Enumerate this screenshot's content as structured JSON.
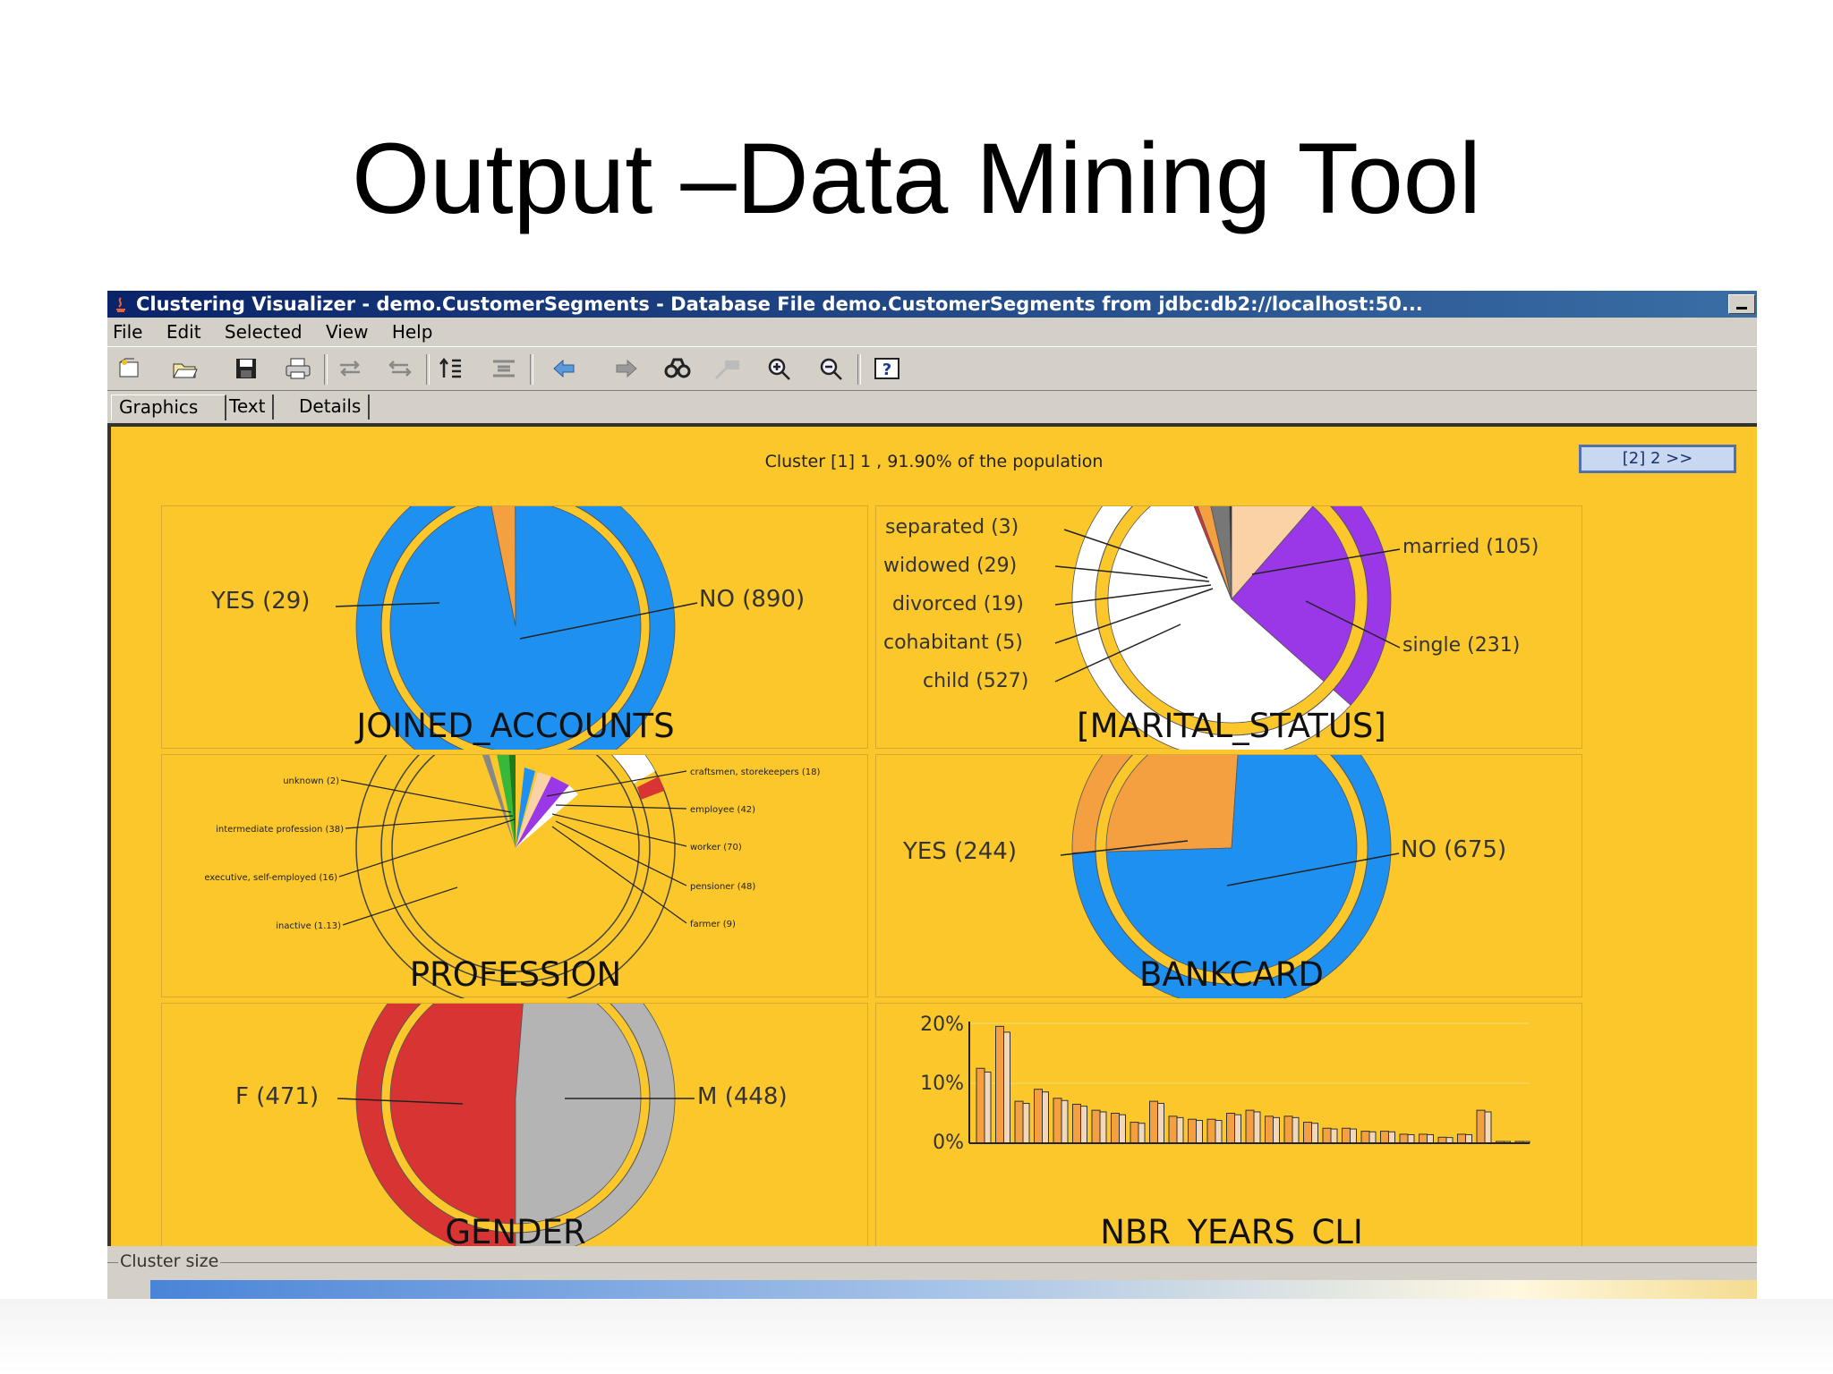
{
  "slide": {
    "title": "Output –Data Mining Tool"
  },
  "window": {
    "title": "Clustering Visualizer - demo.CustomerSegments - Database File demo.CustomerSegments from jdbc:db2://localhost:50...",
    "menu": [
      "File",
      "Edit",
      "Selected",
      "View",
      "Help"
    ],
    "tabs": [
      "Graphics",
      "Text",
      "Details"
    ],
    "toolbar_icons": [
      "new-icon",
      "open-icon",
      "save-icon",
      "print-icon",
      "undo-icon",
      "redo-icon",
      "sort-icon",
      "collapse-icon",
      "back-icon",
      "forward-icon",
      "find-icon",
      "highlight-icon",
      "zoom-in-icon",
      "zoom-out-icon",
      "help-icon"
    ],
    "cluster_header": "Cluster [1] 1 , 91.90% of the population",
    "next_button": "[2] 2 >>",
    "status_label": "Cluster size"
  },
  "colors": {
    "panel": "#fbc72b",
    "blue": "#1e90f0",
    "orange": "#f4a040",
    "purple": "#9a38e8",
    "red": "#d83434",
    "gray": "#b4b4b4",
    "peach": "#fad2a6"
  },
  "charts": {
    "joined_accounts": {
      "title": "JOINED_ACCOUNTS",
      "labels": {
        "yes": "YES (29)",
        "no": "NO (890)"
      },
      "chart_data": {
        "type": "pie",
        "slices": [
          {
            "label": "YES",
            "value": 29,
            "color": "#f4a040"
          },
          {
            "label": "NO",
            "value": 890,
            "color": "#1e90f0"
          }
        ]
      }
    },
    "marital_status": {
      "title": "[MARITAL_STATUS]",
      "labels": {
        "separated": "separated (3)",
        "widowed": "widowed (29)",
        "divorced": "divorced (19)",
        "cohabitant": "cohabitant (5)",
        "child": "child (527)",
        "married": "married (105)",
        "single": "single (231)"
      },
      "chart_data": {
        "type": "pie",
        "slices": [
          {
            "label": "married",
            "value": 105,
            "color": "#fad2a6"
          },
          {
            "label": "single",
            "value": 231,
            "color": "#9a38e8"
          },
          {
            "label": "child",
            "value": 527,
            "color": "#ffffff"
          },
          {
            "label": "cohabitant",
            "value": 5,
            "color": "#d83434"
          },
          {
            "label": "divorced",
            "value": 19,
            "color": "#f4a040"
          },
          {
            "label": "widowed",
            "value": 29,
            "color": "#777777"
          },
          {
            "label": "separated",
            "value": 3,
            "color": "#222222"
          }
        ]
      }
    },
    "profession": {
      "title": "PROFESSION",
      "labels": {
        "unknown": "unknown (2)",
        "intermediate": "intermediate profession (38)",
        "executive": "executive, self-employed (16)",
        "inactive": "inactive (1.13)",
        "craftsmen": "craftsmen, storekeepers (18)",
        "employee": "employee (42)",
        "worker": "worker (70)",
        "pensioner": "pensioner (48)",
        "farmer": "farmer (9)"
      }
    },
    "bankcard": {
      "title": "BANKCARD",
      "labels": {
        "yes": "YES (244)",
        "no": "NO (675)"
      },
      "chart_data": {
        "type": "pie",
        "slices": [
          {
            "label": "YES",
            "value": 244,
            "color": "#f4a040"
          },
          {
            "label": "NO",
            "value": 675,
            "color": "#1e90f0"
          }
        ]
      }
    },
    "gender": {
      "title": "GENDER",
      "labels": {
        "f": "F (471)",
        "m": "M (448)"
      },
      "chart_data": {
        "type": "pie",
        "slices": [
          {
            "label": "F",
            "value": 471,
            "color": "#d83434"
          },
          {
            "label": "M",
            "value": 448,
            "color": "#b4b4b4"
          }
        ]
      }
    },
    "nbr_years": {
      "title": "NBR_YEARS_CLI",
      "y_ticks": [
        "20%",
        "10%",
        "0%"
      ],
      "chart_data": {
        "type": "bar",
        "ylim": [
          0,
          20
        ],
        "values": [
          12.5,
          19.5,
          7,
          9,
          7.5,
          6.5,
          5.5,
          5,
          3.5,
          7,
          4.5,
          4,
          4,
          5,
          5.5,
          4.5,
          4.5,
          3.5,
          2.5,
          2.5,
          2,
          2,
          1.5,
          1.5,
          1,
          1.5,
          5.5,
          0.3,
          0.3
        ]
      }
    }
  }
}
